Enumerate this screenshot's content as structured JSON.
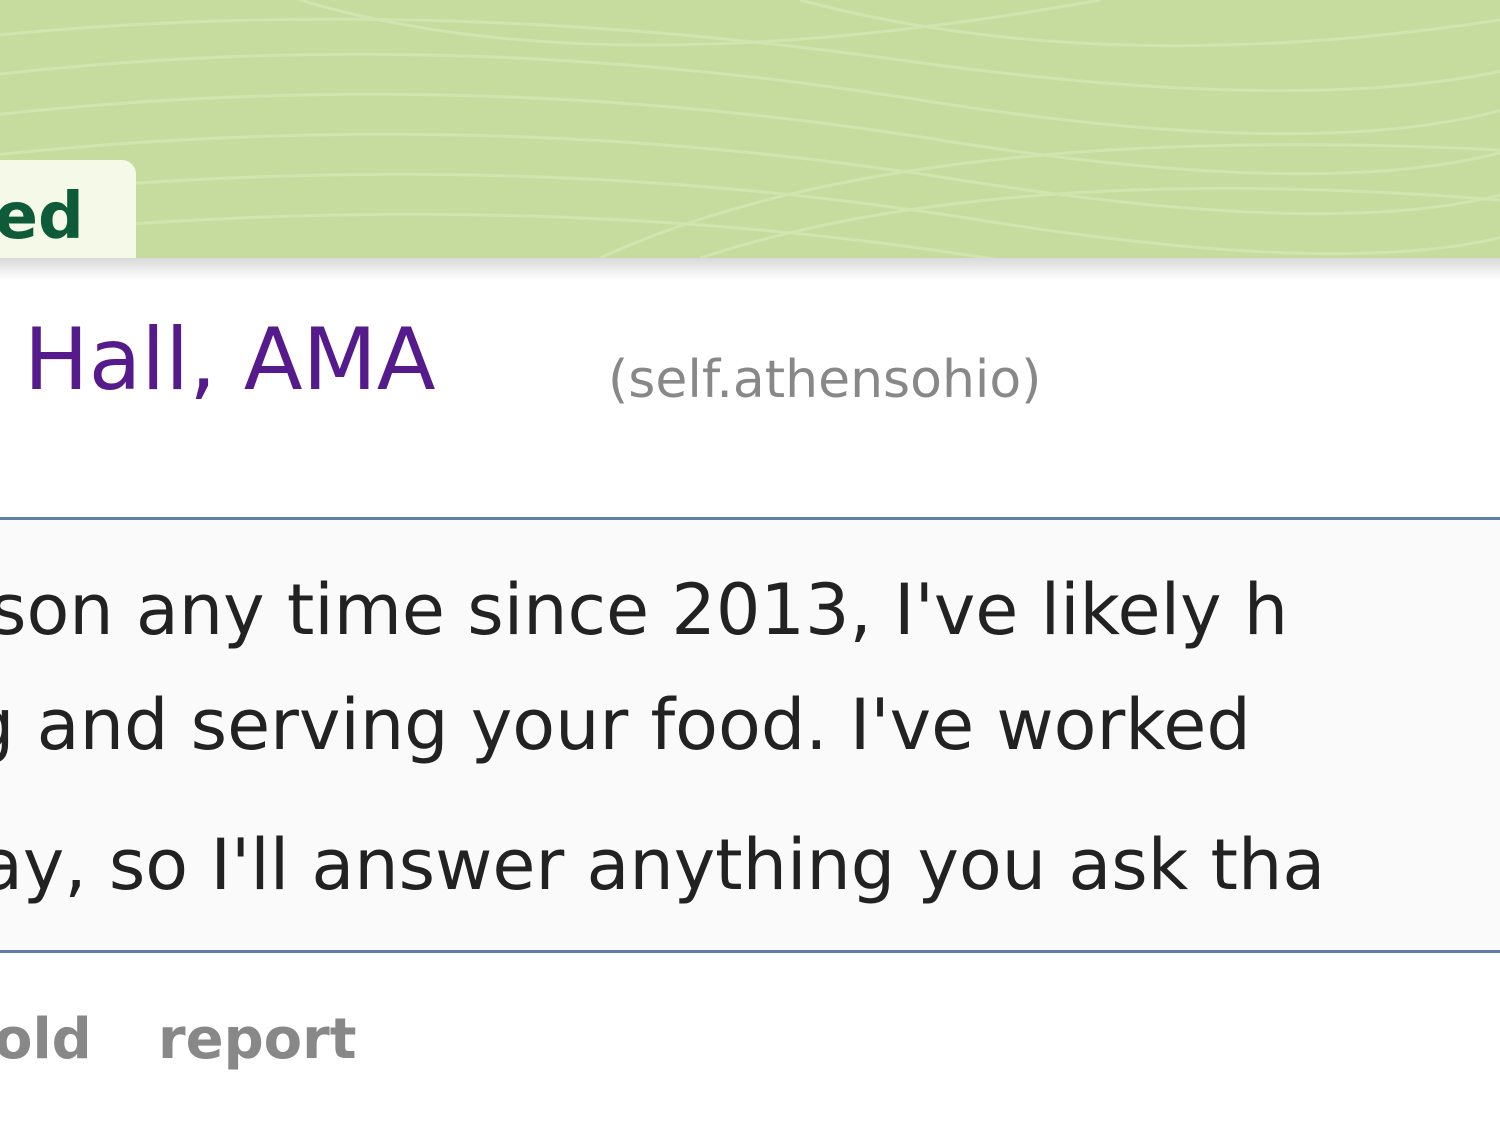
{
  "header": {
    "tab_label": "ted",
    "banner_color": "#c5dc9e",
    "tab_text_color": "#0e5b3a"
  },
  "post": {
    "title": "g Hall, AMA",
    "domain": "(self.athensohio)",
    "title_color": "#551a8b",
    "selftext": {
      "lines": [
        "son any time since 2013, I've likely h",
        "g and serving your food. I've worked",
        "ay, so I'll answer anything you ask tha"
      ]
    }
  },
  "actions": {
    "gold": "old",
    "report": "report"
  }
}
